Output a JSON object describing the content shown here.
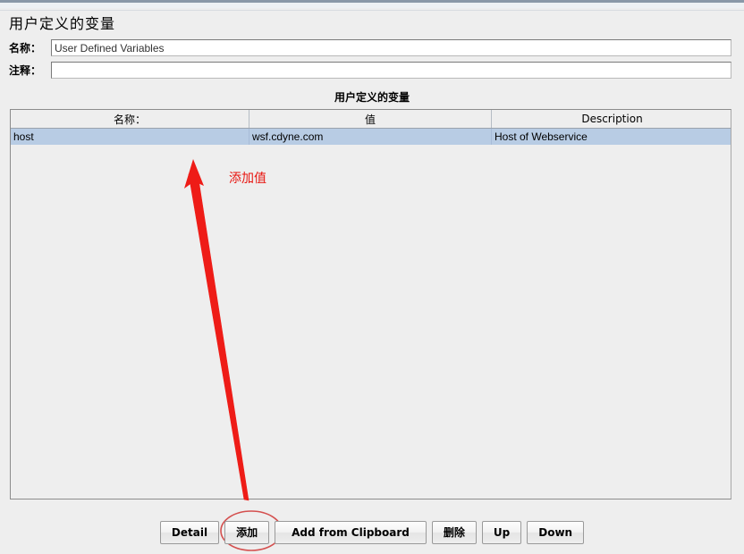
{
  "window": {
    "panel_title": "用户定义的变量"
  },
  "form": {
    "name": {
      "label": "名称：",
      "value": "User Defined Variables",
      "placeholder": ""
    },
    "comment": {
      "label": "注释：",
      "value": "",
      "placeholder": ""
    }
  },
  "table": {
    "caption": "用户定义的变量",
    "columns": [
      "名称：",
      "值",
      "Description"
    ],
    "rows": [
      {
        "name": "host",
        "value": "wsf.cdyne.com",
        "description": "Host of Webservice",
        "selected": true
      }
    ]
  },
  "annotation": {
    "text": "添加值",
    "color": "#e8140f",
    "highlight_target": "add-button"
  },
  "buttons": [
    {
      "label": "Detail",
      "name": "detail-button"
    },
    {
      "label": "添加",
      "name": "add-button"
    },
    {
      "label": "Add from Clipboard",
      "name": "add-from-clipboard-button"
    },
    {
      "label": "删除",
      "name": "delete-button"
    },
    {
      "label": "Up",
      "name": "move-up-button"
    },
    {
      "label": "Down",
      "name": "move-down-button"
    }
  ],
  "colors": {
    "selection": "#b8cce4",
    "panel_bg": "#eeeeee",
    "annotation_red": "#e8140f"
  }
}
